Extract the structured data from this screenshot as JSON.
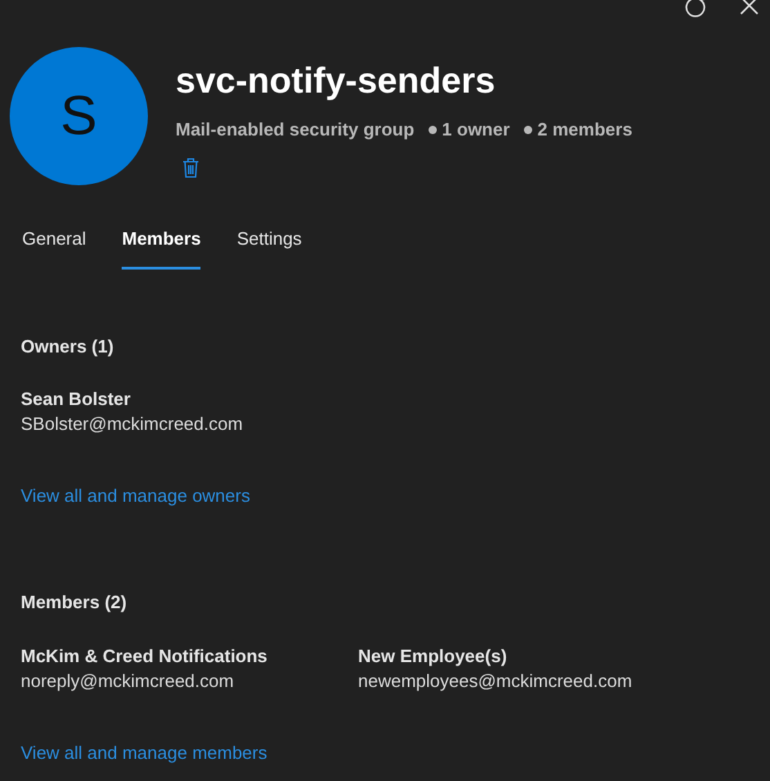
{
  "header": {
    "avatar_initial": "S",
    "title": "svc-notify-senders",
    "type": "Mail-enabled security group",
    "owner_count": "1 owner",
    "member_count": "2 members"
  },
  "tabs": [
    {
      "label": "General",
      "selected": false
    },
    {
      "label": "Members",
      "selected": true
    },
    {
      "label": "Settings",
      "selected": false
    }
  ],
  "owners": {
    "heading": "Owners (1)",
    "people": [
      {
        "name": "Sean Bolster",
        "email": "SBolster@mckimcreed.com"
      }
    ],
    "link": "View all and manage owners"
  },
  "members": {
    "heading": "Members (2)",
    "people": [
      {
        "name": "McKim & Creed Notifications",
        "email": "noreply@mckimcreed.com"
      },
      {
        "name": "New Employee(s)",
        "email": "newemployees@mckimcreed.com"
      }
    ],
    "link": "View all and manage members"
  }
}
